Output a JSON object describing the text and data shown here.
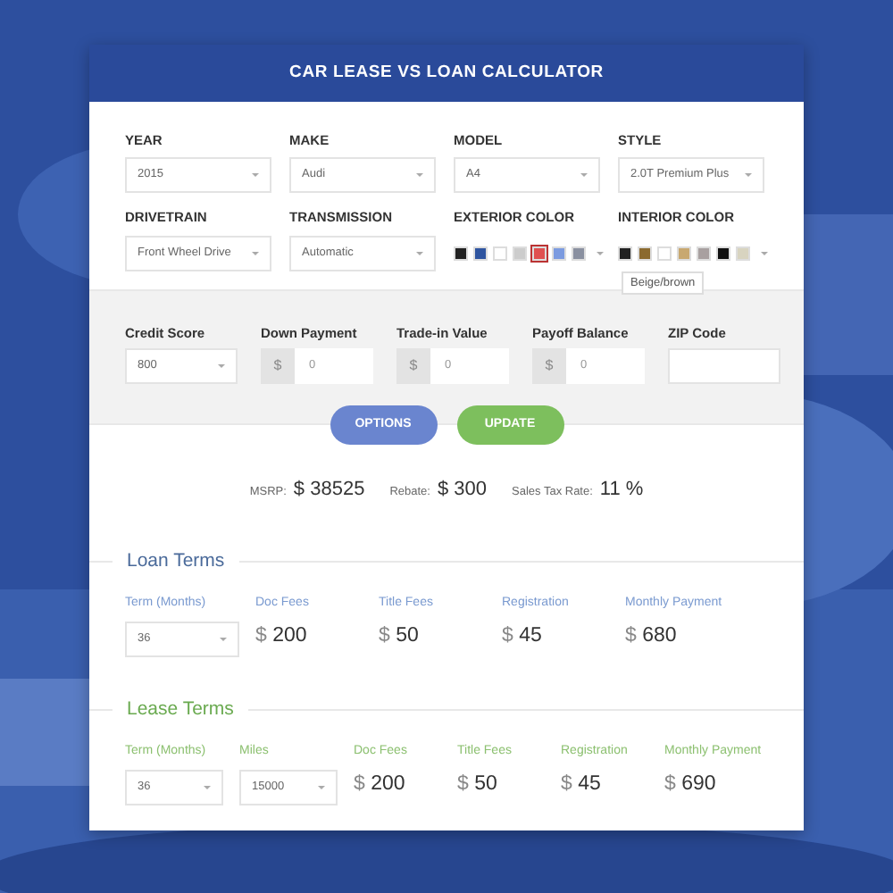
{
  "title": "CAR LEASE VS LOAN CALCULATOR",
  "vehicle_fields": [
    {
      "kind": "select",
      "label": "YEAR",
      "value": "2015"
    },
    {
      "kind": "select",
      "label": "MAKE",
      "value": "Audi"
    },
    {
      "kind": "select",
      "label": "MODEL",
      "value": "A4"
    },
    {
      "kind": "select",
      "label": "STYLE",
      "value": "2.0T Premium Plus"
    },
    {
      "kind": "select",
      "label": "DRIVETRAIN",
      "value": "Front Wheel Drive"
    },
    {
      "kind": "select",
      "label": "TRANSMISSION",
      "value": "Automatic"
    },
    {
      "kind": "swatches",
      "label": "EXTERIOR COLOR",
      "swatches": [
        {
          "color": "#222222",
          "selected": false
        },
        {
          "color": "#2f55a0",
          "selected": false
        },
        {
          "color": "#ffffff",
          "selected": false
        },
        {
          "color": "#cccccc",
          "selected": false
        },
        {
          "color": "#e05050",
          "selected": true
        },
        {
          "color": "#7c9be0",
          "selected": false
        },
        {
          "color": "#8a90a0",
          "selected": false
        }
      ]
    },
    {
      "kind": "swatches",
      "label": "INTERIOR COLOR",
      "swatches": [
        {
          "color": "#222222",
          "selected": false,
          "tooltip": "Beige/brown"
        },
        {
          "color": "#8b6a30",
          "selected": false
        },
        {
          "color": "#ffffff",
          "selected": false
        },
        {
          "color": "#c8a870",
          "selected": false
        },
        {
          "color": "#a8a0a0",
          "selected": false
        },
        {
          "color": "#111111",
          "selected": false
        },
        {
          "color": "#d8d4c0",
          "selected": false
        }
      ]
    }
  ],
  "finance_fields": [
    {
      "kind": "select",
      "label": "Credit Score",
      "value": "800"
    },
    {
      "kind": "money",
      "label": "Down Payment",
      "prefix": "$",
      "value": "0"
    },
    {
      "kind": "money",
      "label": "Trade-in Value",
      "prefix": "$",
      "value": "0"
    },
    {
      "kind": "money",
      "label": "Payoff Balance",
      "prefix": "$",
      "value": "0"
    },
    {
      "kind": "text",
      "label": "ZIP Code"
    }
  ],
  "buttons": [
    {
      "label": "OPTIONS",
      "kind": "options"
    },
    {
      "label": "UPDATE",
      "kind": "update"
    }
  ],
  "summary": [
    {
      "label": "MSRP:",
      "currency": "$",
      "value": "38525"
    },
    {
      "label": "Rebate:",
      "currency": "$",
      "value": "300"
    },
    {
      "label": "Sales Tax Rate:",
      "value": "11",
      "unit": "%"
    }
  ],
  "sections": [
    {
      "title": "Loan Terms",
      "kind": "loan",
      "fields": [
        {
          "kind": "select",
          "label": "Term (Months)",
          "value": "36"
        },
        {
          "kind": "amount",
          "label": "Doc Fees",
          "currency": "$",
          "value": "200"
        },
        {
          "kind": "amount",
          "label": "Title Fees",
          "currency": "$",
          "value": "50"
        },
        {
          "kind": "amount",
          "label": "Registration",
          "currency": "$",
          "value": "45"
        },
        {
          "kind": "amount",
          "label": "Monthly Payment",
          "currency": "$",
          "value": "680"
        }
      ]
    },
    {
      "title": "Lease Terms",
      "kind": "lease",
      "fields": [
        {
          "kind": "select",
          "label": "Term (Months)",
          "value": "36"
        },
        {
          "kind": "select",
          "label": "Miles",
          "value": "15000"
        },
        {
          "kind": "amount",
          "label": "Doc Fees",
          "currency": "$",
          "value": "200"
        },
        {
          "kind": "amount",
          "label": "Title Fees",
          "currency": "$",
          "value": "50"
        },
        {
          "kind": "amount",
          "label": "Registration",
          "currency": "$",
          "value": "45"
        },
        {
          "kind": "amount",
          "label": "Monthly Payment",
          "currency": "$",
          "value": "690"
        }
      ]
    }
  ]
}
